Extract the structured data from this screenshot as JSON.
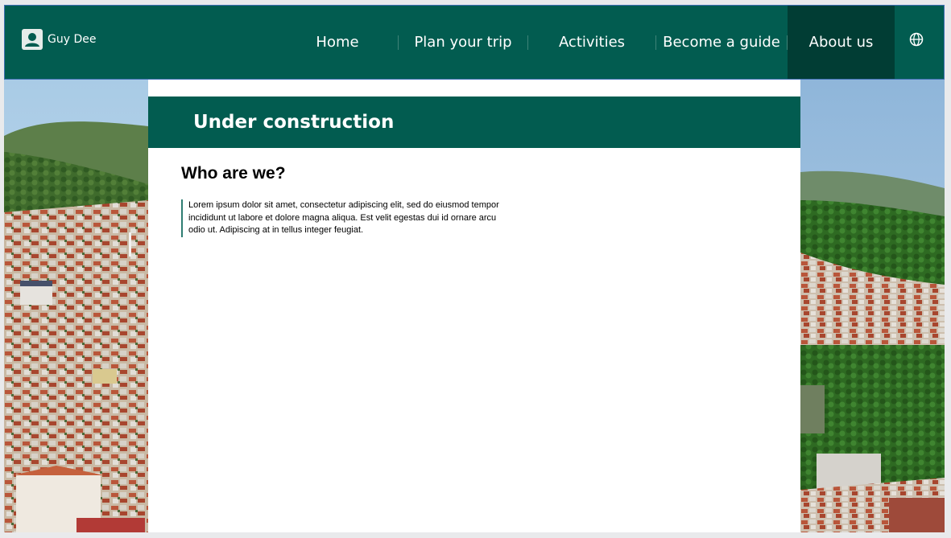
{
  "user": {
    "name": "Guy Dee",
    "icon": "user-avatar-icon"
  },
  "nav": {
    "items": [
      {
        "label": "Home"
      },
      {
        "label": "Plan your trip"
      },
      {
        "label": "Activities"
      },
      {
        "label": "Become a guide"
      },
      {
        "label": "About us"
      }
    ],
    "active": "About us",
    "globe_icon": "globe-icon"
  },
  "banner": {
    "title": "Under construction"
  },
  "section": {
    "title": "Who are we?",
    "text": "Lorem ipsum dolor sit amet, consectetur adipiscing elit, sed do eiusmod tempor incididunt ut labore et dolore magna aliqua. Est velit egestas dui id ornare arcu odio ut. Adipiscing at in tellus integer feugiat."
  },
  "colors": {
    "primary": "#025c50",
    "active_nav": "#013d34",
    "background": "#e9eaec",
    "quote_border": "#2f7d73"
  }
}
